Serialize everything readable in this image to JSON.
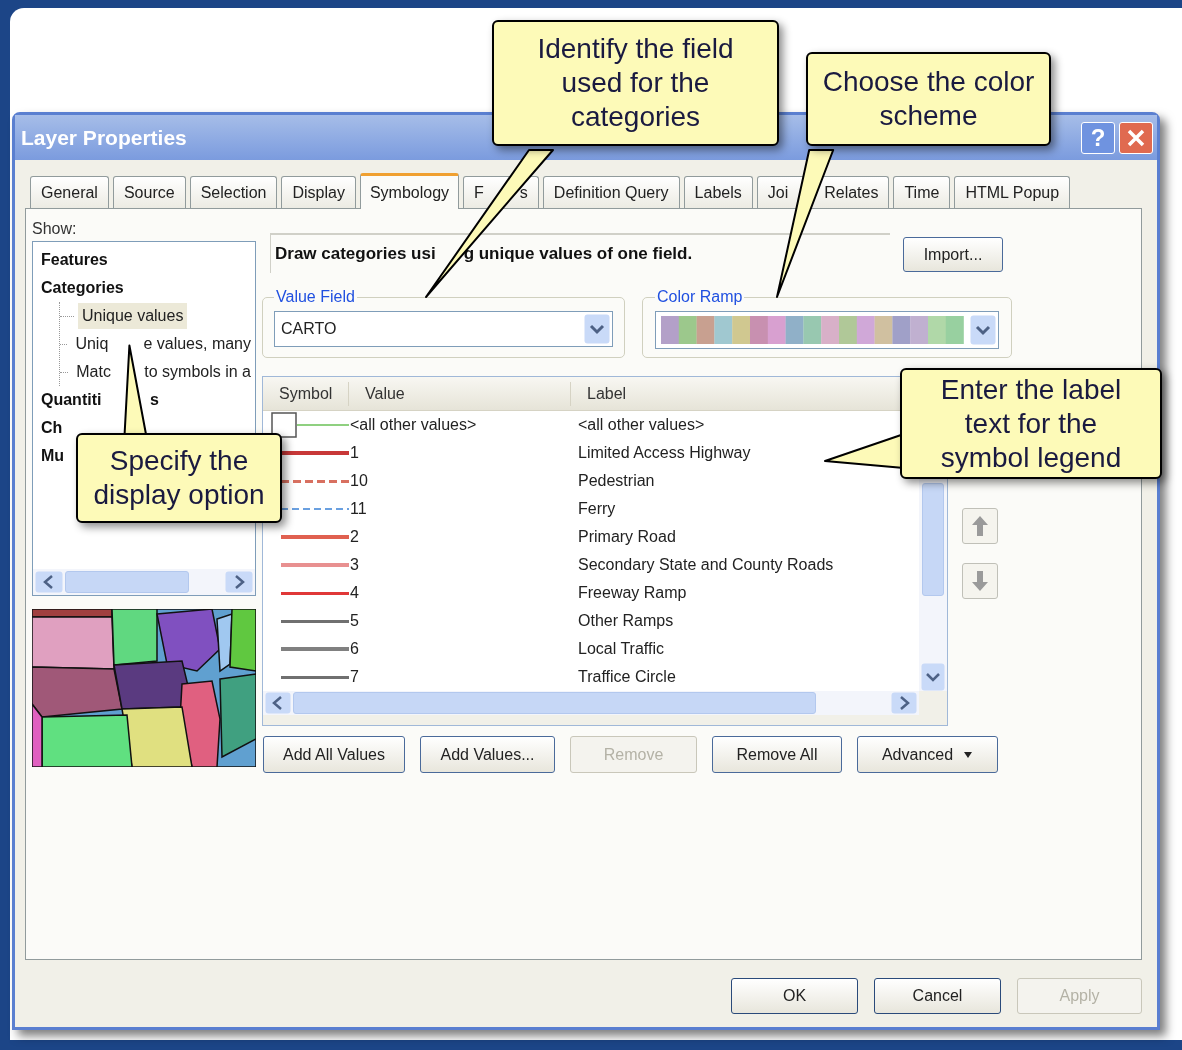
{
  "window": {
    "title": "Layer Properties",
    "help_button": "?"
  },
  "tabs": [
    {
      "label_parts": [
        "General"
      ],
      "selected": false
    },
    {
      "label_parts": [
        "Source"
      ],
      "selected": false
    },
    {
      "label_parts": [
        "Selection"
      ],
      "selected": false
    },
    {
      "label_parts": [
        "Display"
      ],
      "selected": false
    },
    {
      "label_parts": [
        "Symbology"
      ],
      "selected": true
    },
    {
      "label_parts": [
        "F",
        "s"
      ],
      "selected": false
    },
    {
      "label_parts": [
        "Definition Query"
      ],
      "selected": false
    },
    {
      "label_parts": [
        "Labels"
      ],
      "selected": false
    },
    {
      "label_parts": [
        "Joi",
        "Relates"
      ],
      "selected": false
    },
    {
      "label_parts": [
        "Time"
      ],
      "selected": false
    },
    {
      "label_parts": [
        "HTML Popup"
      ],
      "selected": false
    }
  ],
  "show_label": "Show:",
  "tree": [
    {
      "label_parts": [
        "Features"
      ],
      "selected": false
    },
    {
      "label_parts": [
        "Categories"
      ],
      "selected": false,
      "children": [
        {
          "label_parts": [
            "Unique values"
          ],
          "selected": true
        },
        {
          "label_parts": [
            "Uniq",
            "e values, many"
          ],
          "selected": false
        },
        {
          "label_parts": [
            "Matc",
            "to symbols in a"
          ],
          "selected": false
        }
      ]
    },
    {
      "label_parts": [
        "Quantiti",
        "s"
      ],
      "selected": false
    },
    {
      "label_parts": [
        "Ch"
      ],
      "selected": false
    },
    {
      "label_parts": [
        "Mu"
      ],
      "selected": false
    }
  ],
  "heading_parts": [
    "Draw categories usi",
    "g unique values of one field."
  ],
  "import_button": "Import...",
  "value_field": {
    "legend": "Value Field",
    "value": "CARTO"
  },
  "color_ramp": {
    "legend": "Color Ramp"
  },
  "table": {
    "columns": [
      "Symbol",
      "Value",
      "Label"
    ],
    "rows": [
      {
        "symbol": {
          "kind": "default",
          "color": "#8fd080"
        },
        "value": "<all other values>",
        "label": "<all other values>"
      },
      {
        "symbol": {
          "kind": "thick",
          "color": "#c83838"
        },
        "value": "1",
        "label": "Limited Access Highway"
      },
      {
        "symbol": {
          "kind": "dashed",
          "color": "#d87060"
        },
        "value": "10",
        "label": "Pedestrian"
      },
      {
        "symbol": {
          "kind": "dotted",
          "color": "#6aa0e0"
        },
        "value": "11",
        "label": "Ferry"
      },
      {
        "symbol": {
          "kind": "thick",
          "color": "#e06050"
        },
        "value": "2",
        "label": "Primary Road"
      },
      {
        "symbol": {
          "kind": "thick",
          "color": "#e89090"
        },
        "value": "3",
        "label": "Secondary State and County Roads"
      },
      {
        "symbol": {
          "kind": "medium",
          "color": "#e03838"
        },
        "value": "4",
        "label": "Freeway Ramp"
      },
      {
        "symbol": {
          "kind": "medium",
          "color": "#707070"
        },
        "value": "5",
        "label": "Other Ramps"
      },
      {
        "symbol": {
          "kind": "thick",
          "color": "#808080"
        },
        "value": "6",
        "label": "Local Traffic"
      },
      {
        "symbol": {
          "kind": "medium",
          "color": "#707070"
        },
        "value": "7",
        "label": "Traffice Circle"
      }
    ]
  },
  "value_buttons": [
    {
      "label": "Add All Values",
      "disabled": false,
      "kind": "plain"
    },
    {
      "label": "Add Values...",
      "disabled": false,
      "kind": "plain"
    },
    {
      "label": "Remove",
      "disabled": true,
      "kind": "plain"
    },
    {
      "label": "Remove All",
      "disabled": false,
      "kind": "plain"
    },
    {
      "label": "Advanced",
      "disabled": false,
      "kind": "dropdown"
    }
  ],
  "dialog_buttons": [
    {
      "label": "OK",
      "disabled": false
    },
    {
      "label": "Cancel",
      "disabled": false
    },
    {
      "label": "Apply",
      "disabled": true
    }
  ],
  "callouts": [
    {
      "text": "Identify the field\nused for the\ncategories"
    },
    {
      "text": "Choose the color\nscheme"
    },
    {
      "text": "Enter the label\ntext for the\nsymbol legend"
    },
    {
      "text": "Specify the\ndisplay option"
    }
  ]
}
